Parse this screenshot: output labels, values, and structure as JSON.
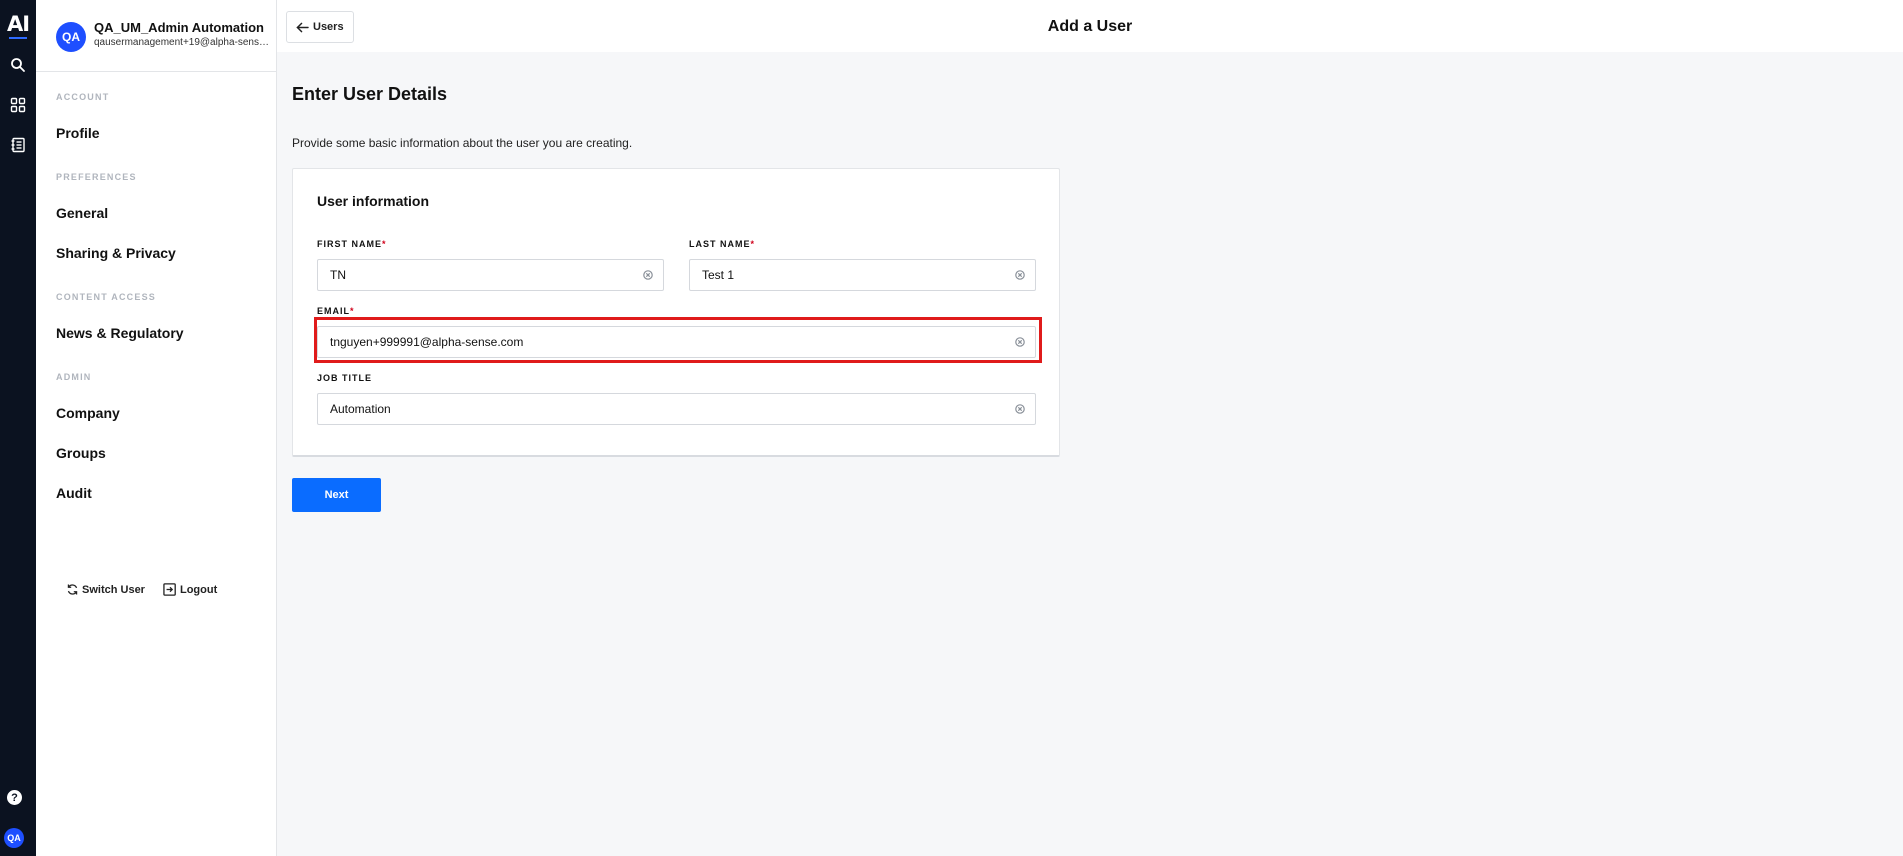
{
  "rail": {
    "logo": "AI",
    "icons": [
      "search-icon",
      "apps-grid-icon",
      "notebook-icon"
    ],
    "help": "?",
    "avatar": "QA"
  },
  "account": {
    "avatar": "QA",
    "name": "QA_UM_Admin Automation",
    "email": "qausermanagement+19@alpha-sense.com"
  },
  "sidebar": {
    "sections": [
      {
        "label": "ACCOUNT",
        "items": [
          "Profile"
        ]
      },
      {
        "label": "PREFERENCES",
        "items": [
          "General",
          "Sharing & Privacy"
        ]
      },
      {
        "label": "CONTENT ACCESS",
        "items": [
          "News & Regulatory"
        ]
      },
      {
        "label": "ADMIN",
        "items": [
          "Company",
          "Groups",
          "Audit"
        ]
      }
    ],
    "switch_user": "Switch User",
    "logout": "Logout"
  },
  "header": {
    "back_label": "Users",
    "title": "Add a User"
  },
  "main": {
    "heading": "Enter User Details",
    "description": "Provide some basic information about the user you are creating."
  },
  "form": {
    "card_title": "User information",
    "first_name": {
      "label": "FIRST NAME",
      "value": "TN",
      "required": "*"
    },
    "last_name": {
      "label": "LAST NAME",
      "value": "Test 1",
      "required": "*"
    },
    "email": {
      "label": "EMAIL",
      "value": "tnguyen+999991@alpha-sense.com",
      "required": "*"
    },
    "job_title": {
      "label": "JOB TITLE",
      "value": "Automation"
    },
    "next_label": "Next"
  },
  "colors": {
    "primary": "#0a6cff",
    "avatar": "#1e4fff",
    "highlight": "#e01b1b",
    "rail": "#0b1220"
  }
}
